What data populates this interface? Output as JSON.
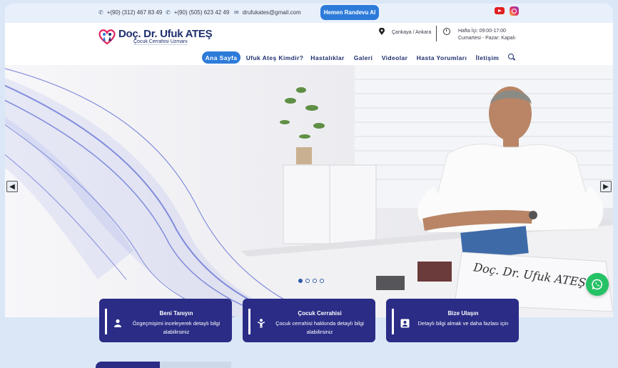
{
  "topbar": {
    "phone1": "+(90) (312) 467 83 49",
    "phone2": "+(90) (505) 623 42 49",
    "email": "drufukates@gmail.com",
    "appointment_button": "Hemen Randevu Al"
  },
  "header": {
    "logo_title": "Doç. Dr. Ufuk ATEŞ",
    "logo_subtitle": "Çocuk Cerrahisi Uzmanı",
    "location": "Çankaya / Ankara",
    "hours_weekday": "Hafta İçi: 09:00-17:00",
    "hours_weekend": "Cumartesi - Pazar: Kapalı"
  },
  "nav": {
    "items": [
      "Ana Sayfa",
      "Ufuk Ateş Kimdir?",
      "Hastalıklar",
      "Galeri",
      "Videolar",
      "Hasta Yorumları",
      "İletişim"
    ]
  },
  "hero": {
    "nameplate": "Doç. Dr. Ufuk ATEŞ",
    "prev_arrow": "◀",
    "next_arrow": "▶"
  },
  "cards": [
    {
      "title": "Beni Tanıyın",
      "text": "Özgeçmişimi inceleyerek detaylı bilgi alabilirsiniz",
      "icon": "person-icon"
    },
    {
      "title": "Çocuk Cerrahisi",
      "text": "Çocuk cerrahisi hakkında detaylı bilgi alabilirsiniz",
      "icon": "child-icon"
    },
    {
      "title": "Bize Ulaşın",
      "text": "Detaylı bilgi almak ve daha fazlası için",
      "icon": "contact-card-icon"
    }
  ],
  "colors": {
    "accent": "#2d7bd9",
    "navy": "#1e2f6e",
    "card": "#2a2c86",
    "whatsapp": "#25c165"
  }
}
